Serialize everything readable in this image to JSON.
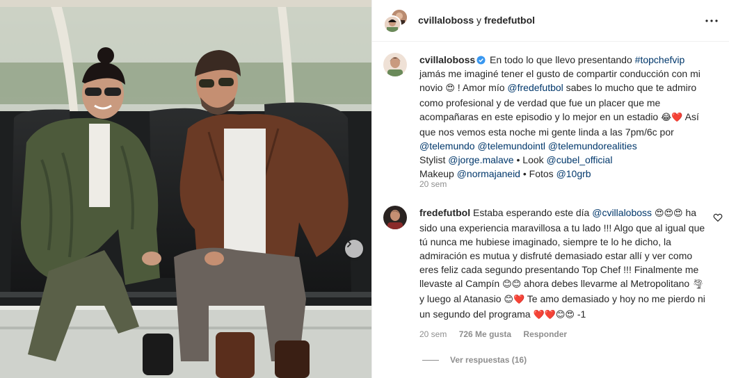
{
  "header": {
    "user1": "cvillaloboss",
    "conjunction": "y",
    "user2": "fredefutbol"
  },
  "caption": {
    "username": "cvillaloboss",
    "t1": " En todo lo que llevo presentando ",
    "hashtag": "#topchefvip",
    "t2": " jamás me imaginé tener el gusto de compartir conducción con mi novio ",
    "e1": "😍",
    "t3": " ! Amor mío ",
    "m1": "@fredefutbol",
    "t4": " sabes lo mucho que te admiro como profesional y de verdad que fue un placer que me acompañaras en este episodio y lo mejor en un estadio ",
    "e2": "😂❤️",
    "t5": " Así que nos vemos esta noche mi gente linda a las 7pm/6c por ",
    "m2": "@telemundo",
    "m3": "@telemundointl",
    "m4": "@telemundorealities",
    "t6": "Stylist ",
    "m5": "@jorge.malave",
    "t7": " • Look ",
    "m6": "@cubel_official",
    "t8": "Makeup ",
    "m7": "@normajaneid",
    "t9": " • Fotos ",
    "m8": "@10grb",
    "time": "20 sem"
  },
  "comment": {
    "username": "fredefutbol",
    "t1": " Estaba esperando este día ",
    "m1": "@cvillaloboss",
    "e1": "😍😍😍",
    "t2": " ha sido una experiencia maravillosa a tu lado !!! Algo que al igual que tú nunca me hubiese imaginado, siempre te lo he dicho, la admiración es mutua y disfruté demasiado estar allí y ver como eres feliz cada segundo presentando Top Chef !!! Finalmente me llevaste al Campín ",
    "e2": "😊😊",
    "t3": " ahora debes llevarme al Metropolitano ",
    "e3": "🌪",
    "t4": " y luego al Atanasio ",
    "e4": "😊❤️",
    "t5": " Te amo demasiado y hoy no me pierdo ni un segundo del programa ",
    "e5": "❤️❤️😊😍",
    "t6": " -1",
    "time": "20 sem",
    "likes": "726 Me gusta",
    "reply": "Responder",
    "view_replies": "Ver respuestas (16)"
  },
  "icons": {
    "verified": "verified-badge-icon",
    "more": "more-options-icon",
    "like": "heart-outline-icon",
    "carousel_next": "chevron-right-icon"
  },
  "colors": {
    "link": "#00376b",
    "verified": "#3897f0",
    "muted": "#8e8e8e",
    "text": "#262626"
  }
}
